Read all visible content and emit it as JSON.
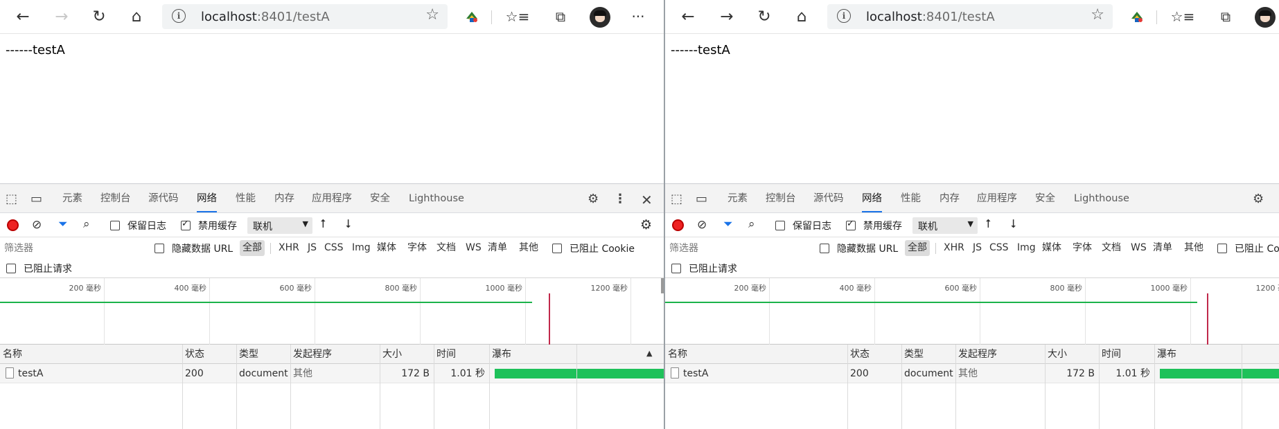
{
  "browser": {
    "url_host": "localhost",
    "url_rest": ":8401/testA",
    "back_icon": "back-arrow-icon",
    "forward_icon": "forward-arrow-icon",
    "refresh_icon": "refresh-icon",
    "home_icon": "home-icon",
    "more": "···"
  },
  "page": {
    "text": "------testA"
  },
  "devtools": {
    "tabs": [
      "元素",
      "控制台",
      "源代码",
      "网络",
      "性能",
      "内存",
      "应用程序",
      "安全",
      "Lighthouse"
    ],
    "active_tab": "网络",
    "preserve_log": "保留日志",
    "disable_cache": "禁用缓存",
    "throttle": "联机",
    "filter_placeholder": "筛选器",
    "hide_data_urls": "隐藏数据 URL",
    "type_filters": [
      "全部",
      "XHR",
      "JS",
      "CSS",
      "Img",
      "媒体",
      "字体",
      "文档",
      "WS",
      "清单",
      "其他"
    ],
    "blocked_cookies": "已阻止 Cookie",
    "blocked_requests": "已阻止请求",
    "timeline_labels": [
      "200 毫秒",
      "400 毫秒",
      "600 毫秒",
      "800 毫秒",
      "1000 毫秒",
      "1200 毫秒"
    ],
    "columns": [
      "名称",
      "状态",
      "类型",
      "发起程序",
      "大小",
      "时间",
      "瀑布"
    ],
    "rows": [
      {
        "name": "testA",
        "status": "200",
        "type": "document",
        "initiator": "其他",
        "size": "172 B",
        "time": "1.01 秒"
      }
    ]
  },
  "colors": {
    "accent": "#1a73e8",
    "record": "#e22222",
    "waterfall": "#1ec15a",
    "marker": "#c0284a"
  }
}
